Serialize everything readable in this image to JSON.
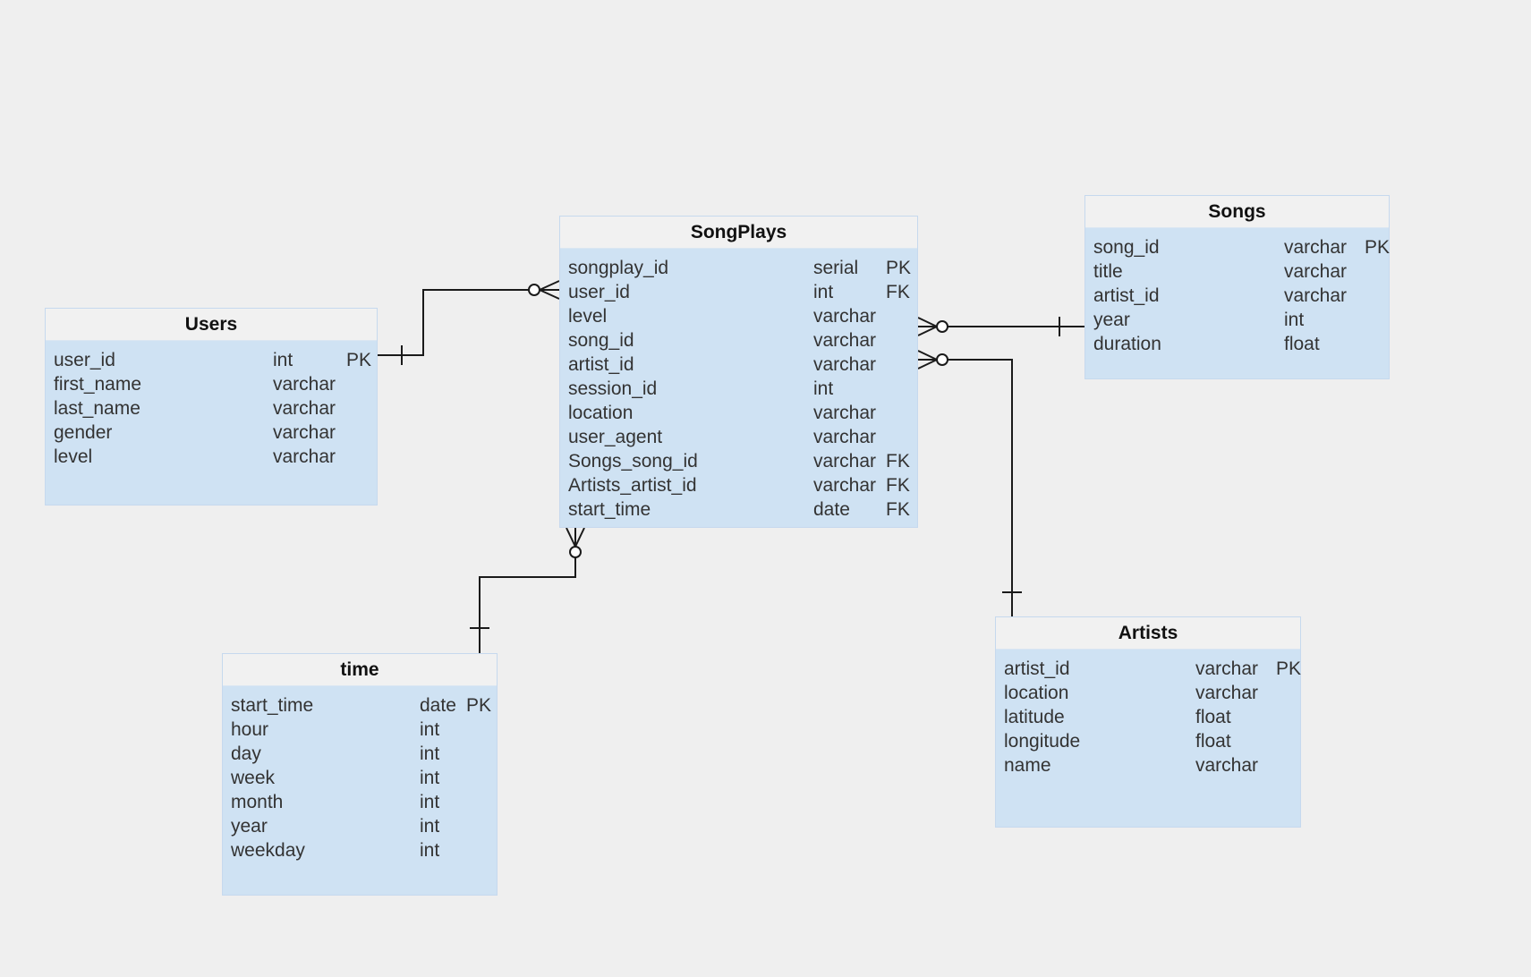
{
  "diagram": {
    "type": "entity-relationship",
    "entities": {
      "songplays": {
        "title": "SongPlays",
        "columns": [
          {
            "name": "songplay_id",
            "type": "serial",
            "key": "PK"
          },
          {
            "name": "user_id",
            "type": "int",
            "key": "FK"
          },
          {
            "name": "level",
            "type": "varchar",
            "key": ""
          },
          {
            "name": "song_id",
            "type": "varchar",
            "key": ""
          },
          {
            "name": "artist_id",
            "type": "varchar",
            "key": ""
          },
          {
            "name": "session_id",
            "type": "int",
            "key": ""
          },
          {
            "name": "location",
            "type": "varchar",
            "key": ""
          },
          {
            "name": "user_agent",
            "type": "varchar",
            "key": ""
          },
          {
            "name": "Songs_song_id",
            "type": "varchar",
            "key": "FK"
          },
          {
            "name": "Artists_artist_id",
            "type": "varchar",
            "key": "FK"
          },
          {
            "name": "start_time",
            "type": "date",
            "key": "FK"
          }
        ]
      },
      "users": {
        "title": "Users",
        "columns": [
          {
            "name": "user_id",
            "type": "int",
            "key": "PK"
          },
          {
            "name": "first_name",
            "type": "varchar",
            "key": ""
          },
          {
            "name": "last_name",
            "type": "varchar",
            "key": ""
          },
          {
            "name": "gender",
            "type": "varchar",
            "key": ""
          },
          {
            "name": "level",
            "type": "varchar",
            "key": ""
          }
        ]
      },
      "songs": {
        "title": "Songs",
        "columns": [
          {
            "name": "song_id",
            "type": "varchar",
            "key": "PK"
          },
          {
            "name": "title",
            "type": "varchar",
            "key": ""
          },
          {
            "name": "artist_id",
            "type": "varchar",
            "key": ""
          },
          {
            "name": "year",
            "type": "int",
            "key": ""
          },
          {
            "name": "duration",
            "type": "float",
            "key": ""
          }
        ]
      },
      "time": {
        "title": "time",
        "columns": [
          {
            "name": "start_time",
            "type": "date",
            "key": "PK"
          },
          {
            "name": "hour",
            "type": "int",
            "key": ""
          },
          {
            "name": "day",
            "type": "int",
            "key": ""
          },
          {
            "name": "week",
            "type": "int",
            "key": ""
          },
          {
            "name": "month",
            "type": "int",
            "key": ""
          },
          {
            "name": "year",
            "type": "int",
            "key": ""
          },
          {
            "name": "weekday",
            "type": "int",
            "key": ""
          }
        ]
      },
      "artists": {
        "title": "Artists",
        "columns": [
          {
            "name": "artist_id",
            "type": "varchar",
            "key": "PK"
          },
          {
            "name": "location",
            "type": "varchar",
            "key": ""
          },
          {
            "name": "latitude",
            "type": "float",
            "key": ""
          },
          {
            "name": "longitude",
            "type": "float",
            "key": ""
          },
          {
            "name": "name",
            "type": "varchar",
            "key": ""
          }
        ]
      }
    },
    "relationships": [
      {
        "from": "Users",
        "to": "SongPlays",
        "from_cardinality": "one",
        "to_cardinality": "zero-or-many"
      },
      {
        "from": "Songs",
        "to": "SongPlays",
        "from_cardinality": "one",
        "to_cardinality": "zero-or-many"
      },
      {
        "from": "Artists",
        "to": "SongPlays",
        "from_cardinality": "one",
        "to_cardinality": "zero-or-many"
      },
      {
        "from": "time",
        "to": "SongPlays",
        "from_cardinality": "one",
        "to_cardinality": "zero-or-many"
      }
    ],
    "colors": {
      "background": "#efefef",
      "entity_body": "#cfe2f3",
      "entity_header": "#f1f1f1",
      "line": "#1a1a1a"
    }
  }
}
